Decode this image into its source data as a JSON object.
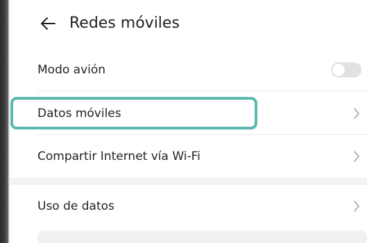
{
  "header": {
    "back_icon": "arrow-left-icon",
    "title": "Redes móviles"
  },
  "rows": [
    {
      "label": "Modo avión",
      "control": "toggle",
      "toggle_on": false
    },
    {
      "label": "Datos móviles",
      "control": "chevron",
      "highlighted": true
    },
    {
      "label": "Compartir Internet vía Wi-Fi",
      "control": "chevron"
    },
    {
      "label": "Uso de datos",
      "control": "chevron"
    }
  ],
  "colors": {
    "highlight": "#5bb8b0",
    "toggle_off": "#e2e2e2",
    "section_gap": "#f2f2f2"
  }
}
